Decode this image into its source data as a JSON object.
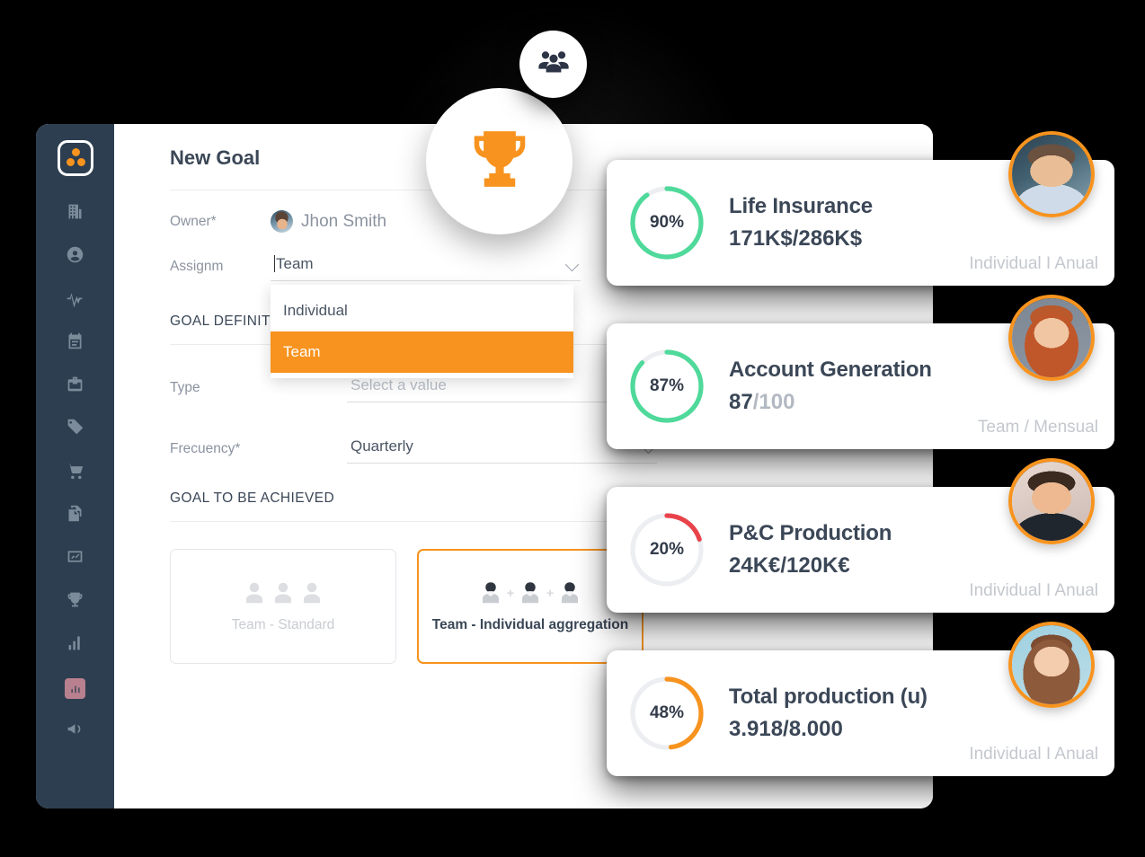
{
  "window": {
    "title": "New Goal"
  },
  "sidebar": {
    "logo_name": "three-dots-logo",
    "items": [
      {
        "name": "sidebar-item-company",
        "icon": "building-icon"
      },
      {
        "name": "sidebar-item-people",
        "icon": "user-circle-icon"
      },
      {
        "name": "sidebar-item-activity",
        "icon": "activity-pulse-icon"
      },
      {
        "name": "sidebar-item-agenda",
        "icon": "calendar-icon"
      },
      {
        "name": "sidebar-item-portfolio",
        "icon": "briefcase-icon"
      },
      {
        "name": "sidebar-item-tags",
        "icon": "tag-icon"
      },
      {
        "name": "sidebar-item-sales",
        "icon": "shopping-cart-icon"
      },
      {
        "name": "sidebar-item-documents",
        "icon": "documents-icon"
      },
      {
        "name": "sidebar-item-trends",
        "icon": "line-chart-icon"
      },
      {
        "name": "sidebar-item-goals",
        "icon": "trophy-icon"
      },
      {
        "name": "sidebar-item-reports",
        "icon": "bar-chart-icon"
      },
      {
        "name": "sidebar-item-analytics",
        "icon": "chart-chip-icon"
      },
      {
        "name": "sidebar-item-campaigns",
        "icon": "megaphone-icon"
      }
    ]
  },
  "form": {
    "owner_label": "Owner*",
    "owner_value": "Jhon Smith",
    "assignment_label": "Assignm",
    "assignment_value": "Team",
    "assignment_options": [
      "Individual",
      "Team"
    ],
    "assignment_selected_index": 1,
    "goal_definition_heading": "GOAL DEFINITION",
    "type_label": "Type",
    "type_placeholder": "Select a value",
    "frequency_label": "Frecuency*",
    "frequency_value": "Quarterly",
    "goal_to_be_achieved_heading": "GOAL TO BE ACHIEVED",
    "options": [
      {
        "label": "Team - Standard",
        "selected": false
      },
      {
        "label": "Team - Individual aggregation",
        "selected": true
      }
    ]
  },
  "floating": {
    "people_icon": "people-group-icon",
    "trophy_icon": "trophy-icon"
  },
  "goal_cards": [
    {
      "percent_label": "90%",
      "percent": 90,
      "title": "Life Insurance",
      "value": "171K$/286K$",
      "denominator": "",
      "meta": "Individual I Anual",
      "ring_color": "#4fd99a",
      "avatar_name": "avatar-life-insurance-owner"
    },
    {
      "percent_label": "87%",
      "percent": 87,
      "title": "Account Generation",
      "value": "87",
      "denominator": "/100",
      "meta": "Team / Mensual",
      "ring_color": "#4fd99a",
      "avatar_name": "avatar-account-generation-owner"
    },
    {
      "percent_label": "20%",
      "percent": 20,
      "title": "P&C Production",
      "value": "24K€/120K€",
      "denominator": "",
      "meta": "Individual I Anual",
      "ring_color": "#e8434a",
      "avatar_name": "avatar-pc-production-owner"
    },
    {
      "percent_label": "48%",
      "percent": 48,
      "title": "Total production (u)",
      "value": "3.918/8.000",
      "denominator": "",
      "meta": "Individual I Anual",
      "ring_color": "#f7931e",
      "avatar_name": "avatar-total-production-owner"
    }
  ],
  "colors": {
    "accent_orange": "#f7931e",
    "sidebar_bg": "#2d3e50",
    "ring_green": "#4fd99a",
    "ring_red": "#e8434a",
    "ring_track": "#eceef1",
    "text_dark": "#3b4757",
    "text_muted": "#b3b9c2",
    "page_bg": "#000000"
  }
}
